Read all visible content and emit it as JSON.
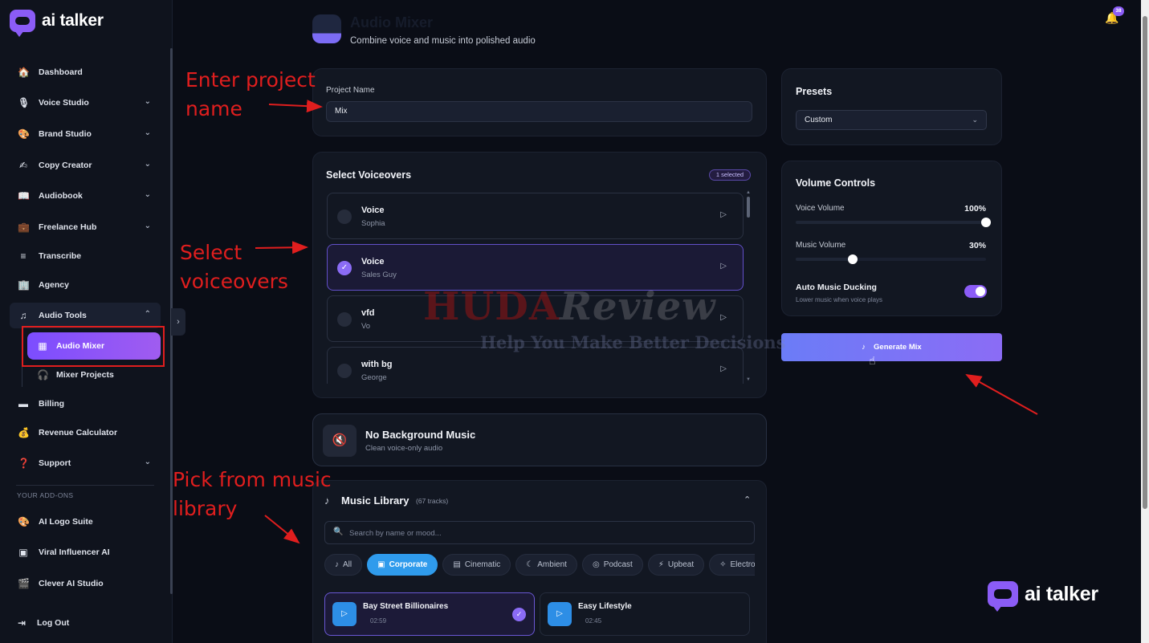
{
  "app": {
    "logo_text": "ai talker"
  },
  "sidebar": {
    "items": [
      {
        "label": "Dashboard",
        "icon": "🏠"
      },
      {
        "label": "Voice Studio",
        "icon": "🎙",
        "chevron": "⌄"
      },
      {
        "label": "Brand Studio",
        "icon": "🎨",
        "chevron": "⌄"
      },
      {
        "label": "Copy Creator",
        "icon": "✍",
        "chevron": "⌄"
      },
      {
        "label": "Audiobook",
        "icon": "📖",
        "chevron": "⌄"
      },
      {
        "label": "Freelance Hub",
        "icon": "💼",
        "chevron": "⌄"
      },
      {
        "label": "Transcribe",
        "icon": "≡"
      },
      {
        "label": "Agency",
        "icon": "🏢"
      },
      {
        "label": "Audio Tools",
        "icon": "♫",
        "chevron": "⌃"
      },
      {
        "label": "Billing",
        "icon": "▬"
      },
      {
        "label": "Revenue Calculator",
        "icon": "💰"
      },
      {
        "label": "Support",
        "icon": "❓",
        "chevron": "⌄"
      }
    ],
    "sub_items": [
      {
        "label": "Audio Mixer",
        "icon": "▦"
      },
      {
        "label": "Mixer Projects",
        "icon": "🎧"
      }
    ],
    "addons_label": "YOUR ADD-ONS",
    "addons": [
      {
        "label": "AI Logo Suite",
        "icon": "🎨"
      },
      {
        "label": "Viral Influencer AI",
        "icon": "▣"
      },
      {
        "label": "Clever AI Studio",
        "icon": "🎬"
      }
    ],
    "logout": {
      "label": "Log Out",
      "icon": "⇥"
    },
    "collapse_icon": "›"
  },
  "header": {
    "title": "Audio Mixer",
    "subtitle": "Combine voice and music into polished audio",
    "notification_count": "38",
    "bell_icon": "🔔"
  },
  "project": {
    "label": "Project Name",
    "value": "Mix"
  },
  "voiceovers": {
    "title": "Select Voiceovers",
    "selected_badge": "1 selected",
    "check_icon": "✓",
    "play_icon": "▷",
    "items": [
      {
        "name": "Voice",
        "voice": "Sophia",
        "selected": false
      },
      {
        "name": "Voice",
        "voice": "Sales Guy",
        "selected": true
      },
      {
        "name": "vfd",
        "voice": "Vo",
        "selected": false
      },
      {
        "name": "with bg",
        "voice": "George",
        "selected": false
      }
    ]
  },
  "no_music": {
    "title": "No Background Music",
    "subtitle": "Clean voice-only audio",
    "icon": "🔇"
  },
  "music_library": {
    "title": "Music Library",
    "count": "(67 tracks)",
    "icon": "♪",
    "collapse_icon": "⌃",
    "search_placeholder": "Search by name or mood...",
    "search_icon": "🔍",
    "chips": [
      {
        "label": "All",
        "icon": "♪",
        "active": false
      },
      {
        "label": "Corporate",
        "icon": "▣",
        "active": true
      },
      {
        "label": "Cinematic",
        "icon": "▤",
        "active": false
      },
      {
        "label": "Ambient",
        "icon": "☾",
        "active": false
      },
      {
        "label": "Podcast",
        "icon": "◎",
        "active": false
      },
      {
        "label": "Upbeat",
        "icon": "⚡",
        "active": false
      },
      {
        "label": "Electron",
        "icon": "✧",
        "active": false
      }
    ],
    "tracks": [
      {
        "name": "Bay Street Billionaires",
        "duration": "02:59",
        "selected": true
      },
      {
        "name": "Easy Lifestyle",
        "duration": "02:45",
        "selected": false
      }
    ]
  },
  "presets": {
    "title": "Presets",
    "value": "Custom",
    "chevron": "⌄"
  },
  "volume": {
    "title": "Volume Controls",
    "voice_label": "Voice Volume",
    "voice_value": "100%",
    "voice_level": 1.0,
    "music_label": "Music Volume",
    "music_value": "30%",
    "music_level": 0.3,
    "ducking_title": "Auto Music Ducking",
    "ducking_sub": "Lower music when voice plays",
    "ducking_on": true
  },
  "generate": {
    "label": "Generate Mix",
    "icon": "♪"
  },
  "annotations": {
    "enter_project_1": "Enter project",
    "enter_project_2": "name",
    "select_vo_1": "Select",
    "select_vo_2": "voiceovers",
    "pick_music_1": "Pick from music",
    "pick_music_2": "library"
  },
  "watermark": {
    "huda": "HUDA",
    "review": "Review",
    "tagline": "Help You Make Better Decisions"
  },
  "colors": {
    "accent": "#8b5cf6",
    "chip_active": "#2f9bec",
    "annotation": "#e01e1e"
  }
}
